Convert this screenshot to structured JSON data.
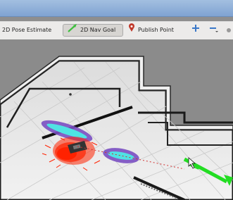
{
  "toolbar": {
    "tools": [
      {
        "label": "2D Pose Estimate",
        "icon": "pose-arrow-icon"
      },
      {
        "label": "2D Nav Goal",
        "icon": "goal-arrow-icon",
        "active": true
      },
      {
        "label": "Publish Point",
        "icon": "map-pin-icon"
      }
    ],
    "extra_icons": [
      "move-camera-icon",
      "zoom-minus-icon"
    ],
    "accent_green": "#3fbf3f",
    "pin_color": "#c0392b"
  },
  "viewport": {
    "map_wall_color": "#222222",
    "floor_color": "#e9e9e9",
    "costmap_inflation_color": "#7a4fc2",
    "costmap_lethal_color": "#4fe3e3",
    "particle_color": "#ff2200",
    "goal_arrow_color": "#22dd22"
  }
}
